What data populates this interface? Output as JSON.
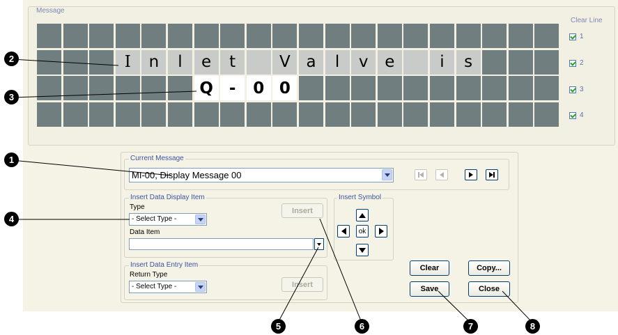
{
  "message": {
    "legend": "Message",
    "clear_line_label": "Clear Line",
    "rows": [
      {
        "cells": [
          {
            "t": "",
            "s": 0
          },
          {
            "t": "",
            "s": 0
          },
          {
            "t": "",
            "s": 0
          },
          {
            "t": "",
            "s": 0
          },
          {
            "t": "",
            "s": 0
          },
          {
            "t": "",
            "s": 0
          },
          {
            "t": "",
            "s": 0
          },
          {
            "t": "",
            "s": 0
          },
          {
            "t": "",
            "s": 0
          },
          {
            "t": "",
            "s": 0
          },
          {
            "t": "",
            "s": 0
          },
          {
            "t": "",
            "s": 0
          },
          {
            "t": "",
            "s": 0
          },
          {
            "t": "",
            "s": 0
          },
          {
            "t": "",
            "s": 0
          },
          {
            "t": "",
            "s": 0
          },
          {
            "t": "",
            "s": 0
          },
          {
            "t": "",
            "s": 0
          },
          {
            "t": "",
            "s": 0
          },
          {
            "t": "",
            "s": 0
          }
        ]
      },
      {
        "cells": [
          {
            "t": "",
            "s": 0
          },
          {
            "t": "",
            "s": 0
          },
          {
            "t": "",
            "s": 0
          },
          {
            "t": "I",
            "s": 1,
            "f": "serif"
          },
          {
            "t": "n",
            "s": 1
          },
          {
            "t": "l",
            "s": 1
          },
          {
            "t": "e",
            "s": 1
          },
          {
            "t": "t",
            "s": 1
          },
          {
            "t": "",
            "s": 1
          },
          {
            "t": "V",
            "s": 1
          },
          {
            "t": "a",
            "s": 1
          },
          {
            "t": "l",
            "s": 1
          },
          {
            "t": "v",
            "s": 1
          },
          {
            "t": "e",
            "s": 1
          },
          {
            "t": "",
            "s": 1
          },
          {
            "t": "i",
            "s": 1
          },
          {
            "t": "s",
            "s": 1
          },
          {
            "t": "",
            "s": 0
          },
          {
            "t": "",
            "s": 0
          },
          {
            "t": "",
            "s": 0
          }
        ]
      },
      {
        "cells": [
          {
            "t": "",
            "s": 0
          },
          {
            "t": "",
            "s": 0
          },
          {
            "t": "",
            "s": 0
          },
          {
            "t": "",
            "s": 0
          },
          {
            "t": "",
            "s": 0
          },
          {
            "t": "",
            "s": 0
          },
          {
            "t": "Q",
            "s": 2,
            "f": "bold"
          },
          {
            "t": "-",
            "s": 2,
            "f": "bold"
          },
          {
            "t": "0",
            "s": 2,
            "f": "bold"
          },
          {
            "t": "0",
            "s": 2,
            "f": "bold"
          },
          {
            "t": "",
            "s": 0
          },
          {
            "t": "",
            "s": 0
          },
          {
            "t": "",
            "s": 0
          },
          {
            "t": "",
            "s": 0
          },
          {
            "t": "",
            "s": 0
          },
          {
            "t": "",
            "s": 0
          },
          {
            "t": "",
            "s": 0
          },
          {
            "t": "",
            "s": 0
          },
          {
            "t": "",
            "s": 0
          },
          {
            "t": "",
            "s": 0
          }
        ]
      },
      {
        "cells": [
          {
            "t": "",
            "s": 0
          },
          {
            "t": "",
            "s": 0
          },
          {
            "t": "",
            "s": 0
          },
          {
            "t": "",
            "s": 0
          },
          {
            "t": "",
            "s": 0
          },
          {
            "t": "",
            "s": 0
          },
          {
            "t": "",
            "s": 0
          },
          {
            "t": "",
            "s": 0
          },
          {
            "t": "",
            "s": 0
          },
          {
            "t": "",
            "s": 0
          },
          {
            "t": "",
            "s": 0
          },
          {
            "t": "",
            "s": 0
          },
          {
            "t": "",
            "s": 0
          },
          {
            "t": "",
            "s": 0
          },
          {
            "t": "",
            "s": 0
          },
          {
            "t": "",
            "s": 0
          },
          {
            "t": "",
            "s": 0
          },
          {
            "t": "",
            "s": 0
          },
          {
            "t": "",
            "s": 0
          },
          {
            "t": "",
            "s": 0
          }
        ]
      }
    ],
    "clear_lines": [
      {
        "label": "1",
        "checked": true
      },
      {
        "label": "2",
        "checked": true
      },
      {
        "label": "3",
        "checked": true
      },
      {
        "label": "4",
        "checked": true
      }
    ]
  },
  "current_message": {
    "legend": "Current Message",
    "selected": "MI-00,  Display Message 00"
  },
  "insert_data_display": {
    "legend": "Insert Data Display Item",
    "type_label": "Type",
    "type_value": "- Select Type -",
    "data_item_label": "Data Item",
    "data_item_value": "",
    "insert_label": "Insert"
  },
  "insert_symbol": {
    "legend": "Insert Symbol",
    "ok_label": "ok"
  },
  "insert_data_entry": {
    "legend": "Insert Data Entry Item",
    "return_type_label": "Return Type",
    "return_type_value": "- Select Type -",
    "insert_label": "Insert"
  },
  "buttons": {
    "clear": "Clear",
    "copy": "Copy...",
    "save": "Save",
    "close": "Close"
  },
  "callouts": [
    "1",
    "2",
    "3",
    "4",
    "5",
    "6",
    "7",
    "8"
  ],
  "colors": {
    "cell_dark": "#707e80",
    "cell_lit": "#c8cbc8",
    "cell_selected": "#ffffff",
    "panel_bg": "#f5f3e6",
    "legend_blue": "#3c52a0"
  }
}
